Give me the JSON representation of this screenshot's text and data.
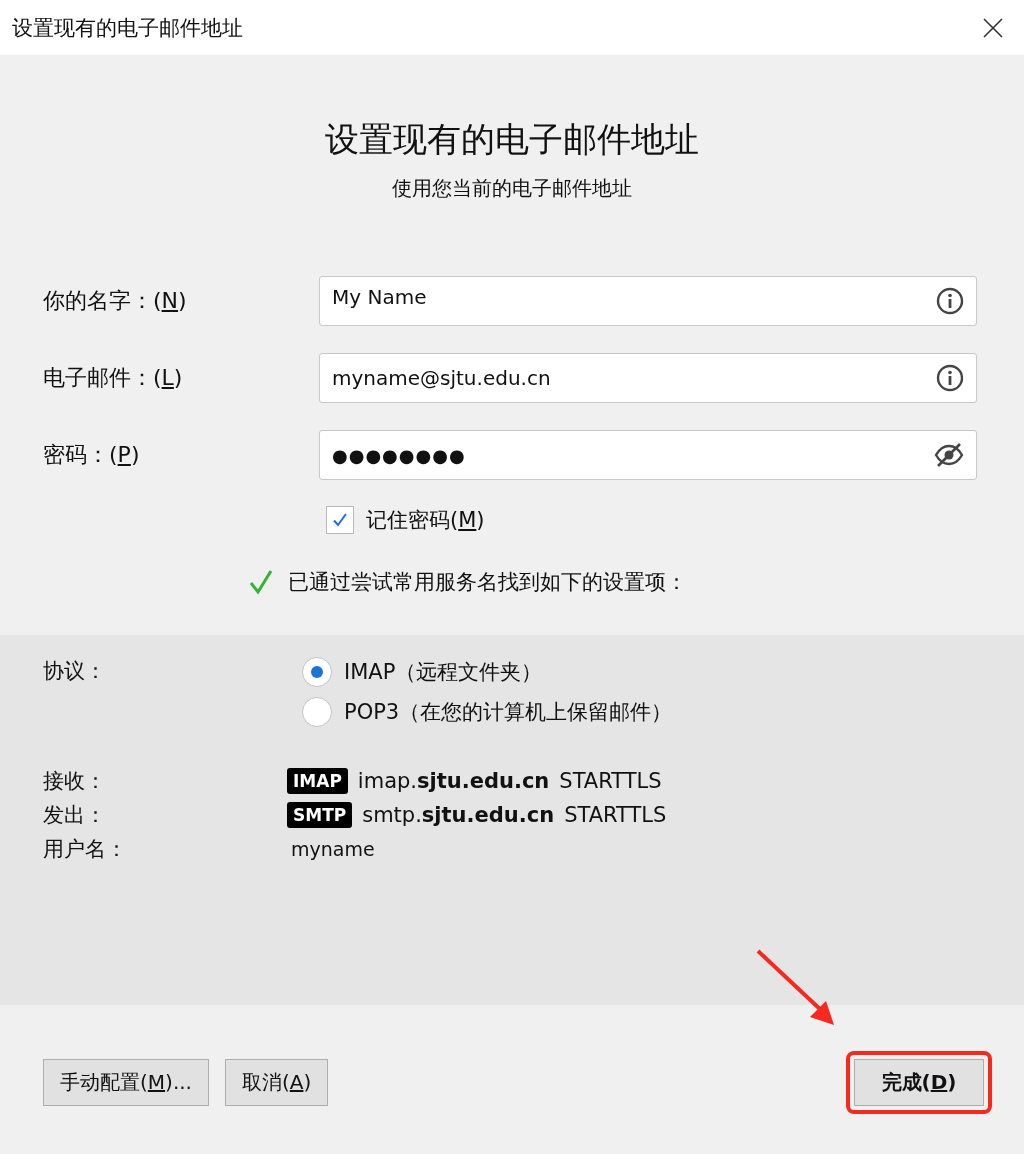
{
  "window": {
    "title": "设置现有的电子邮件地址"
  },
  "heading": "设置现有的电子邮件地址",
  "subheading": "使用您当前的电子邮件地址",
  "fields": [
    {
      "label": {
        "pre": "你的名字：(",
        "key": "N",
        "post": ")"
      },
      "value": "My Name",
      "kind": "text"
    },
    {
      "label": {
        "pre": "电子邮件：(",
        "key": "L",
        "post": ")"
      },
      "value": "myname@sjtu.edu.cn",
      "kind": "text"
    },
    {
      "label": {
        "pre": "密码：(",
        "key": "P",
        "post": ")"
      },
      "value": "●●●●●●●●",
      "kind": "password"
    }
  ],
  "remember": {
    "label": {
      "pre": "记住密码(",
      "key": "M",
      "post": ")"
    },
    "checked": true
  },
  "status": "已通过尝试常用服务名找到如下的设置项：",
  "protocol": {
    "label": "协议：",
    "options": [
      {
        "label": "IMAP（远程文件夹）",
        "selected": true
      },
      {
        "label": "POP3（在您的计算机上保留邮件）",
        "selected": false
      }
    ]
  },
  "servers": [
    {
      "label": "接收：",
      "badge": "IMAP",
      "host": "imap.**sjtu.edu.cn**",
      "security": "STARTTLS"
    },
    {
      "label": "发出：",
      "badge": "SMTP",
      "host": "smtp.**sjtu.edu.cn**",
      "security": "STARTTLS"
    }
  ],
  "username": {
    "label": "用户名：",
    "value": "myname"
  },
  "buttons": [
    {
      "label": {
        "pre": "手动配置(",
        "key": "M",
        "post": ")..."
      },
      "kind": "normal"
    },
    {
      "label": {
        "pre": "取消(",
        "key": "A",
        "post": ")"
      },
      "kind": "normal"
    },
    {
      "label": {
        "pre": "完成(",
        "key": "D",
        "post": ")"
      },
      "kind": "primary"
    }
  ],
  "annotation": {
    "highlighted": true
  }
}
